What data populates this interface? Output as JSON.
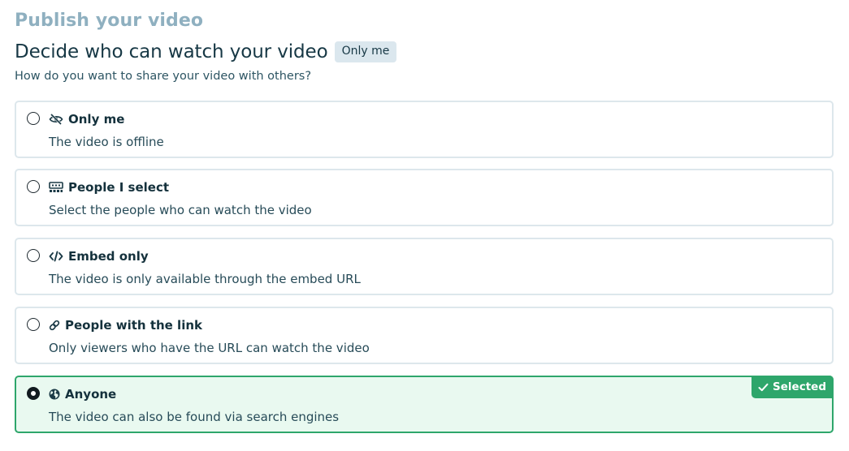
{
  "page": {
    "title": "Publish your video"
  },
  "section": {
    "title": "Decide who can watch your video",
    "current_badge": "Only me",
    "subtitle": "How do you want to share your video with others?"
  },
  "options": [
    {
      "icon": "eye-slash-icon",
      "title": "Only me",
      "description": "The video is offline",
      "selected": false
    },
    {
      "icon": "people-grid-icon",
      "title": "People I select",
      "description": "Select the people who can watch the video",
      "selected": false
    },
    {
      "icon": "code-icon",
      "title": "Embed only",
      "description": "The video is only available through the embed URL",
      "selected": false
    },
    {
      "icon": "link-icon",
      "title": "People with the link",
      "description": "Only viewers who have the URL can watch the video",
      "selected": false
    },
    {
      "icon": "globe-icon",
      "title": "Anyone",
      "description": "The video can also be found via search engines",
      "selected": true,
      "badge": "Selected"
    }
  ],
  "colors": {
    "title_muted": "#8fb0c0",
    "text_dark": "#173845",
    "border": "#dde7ec",
    "selected_border": "#2ea66b",
    "selected_bg": "#e9f9f0",
    "badge_bg": "#dbe7ee"
  }
}
